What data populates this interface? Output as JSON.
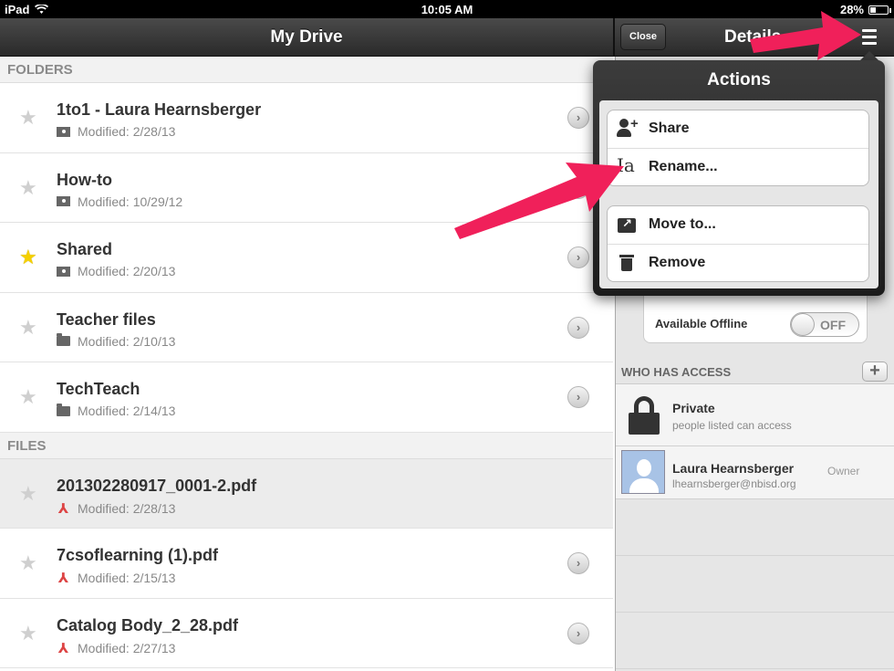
{
  "status": {
    "device": "iPad",
    "time": "10:05 AM",
    "battery": "28%",
    "battery_level": 0.28
  },
  "nav": {
    "title": "My Drive",
    "close_label": "Close",
    "details_title": "Details"
  },
  "folders_header": "FOLDERS",
  "files_header": "FILES",
  "folders": [
    {
      "name": "1to1 - Laura Hearnsberger",
      "modified": "Modified: 2/28/13",
      "starred": false,
      "icon": "shared-folder-icon"
    },
    {
      "name": "How-to",
      "modified": "Modified: 10/29/12",
      "starred": false,
      "icon": "shared-folder-icon"
    },
    {
      "name": "Shared",
      "modified": "Modified: 2/20/13",
      "starred": true,
      "icon": "shared-folder-icon"
    },
    {
      "name": "Teacher files",
      "modified": "Modified: 2/10/13",
      "starred": false,
      "icon": "folder-icon"
    },
    {
      "name": "TechTeach",
      "modified": "Modified: 2/14/13",
      "starred": false,
      "icon": "folder-icon"
    }
  ],
  "files": [
    {
      "name": "201302280917_0001-2.pdf",
      "modified": "Modified: 2/28/13",
      "starred": false,
      "selected": true,
      "icon": "pdf-icon"
    },
    {
      "name": "7csoflearning (1).pdf",
      "modified": "Modified: 2/15/13",
      "starred": false,
      "selected": false,
      "icon": "pdf-icon"
    },
    {
      "name": "Catalog Body_2_28.pdf",
      "modified": "Modified: 2/27/13",
      "starred": false,
      "selected": false,
      "icon": "pdf-icon"
    }
  ],
  "actions": {
    "title": "Actions",
    "share": "Share",
    "rename": "Rename...",
    "move": "Move to...",
    "remove": "Remove"
  },
  "details": {
    "offline_label": "Available Offline",
    "offline_state": "OFF",
    "access_header": "WHO HAS ACCESS",
    "add_label": "+",
    "privacy_title": "Private",
    "privacy_sub": "people listed can access",
    "owner_name": "Laura Hearnsberger",
    "owner_email": "lhearnsberger@nbisd.org",
    "owner_role": "Owner"
  },
  "colors": {
    "star_on": "#f5d000",
    "annotation_arrow": "#f0205a",
    "pdf_icon": "#d44444"
  }
}
